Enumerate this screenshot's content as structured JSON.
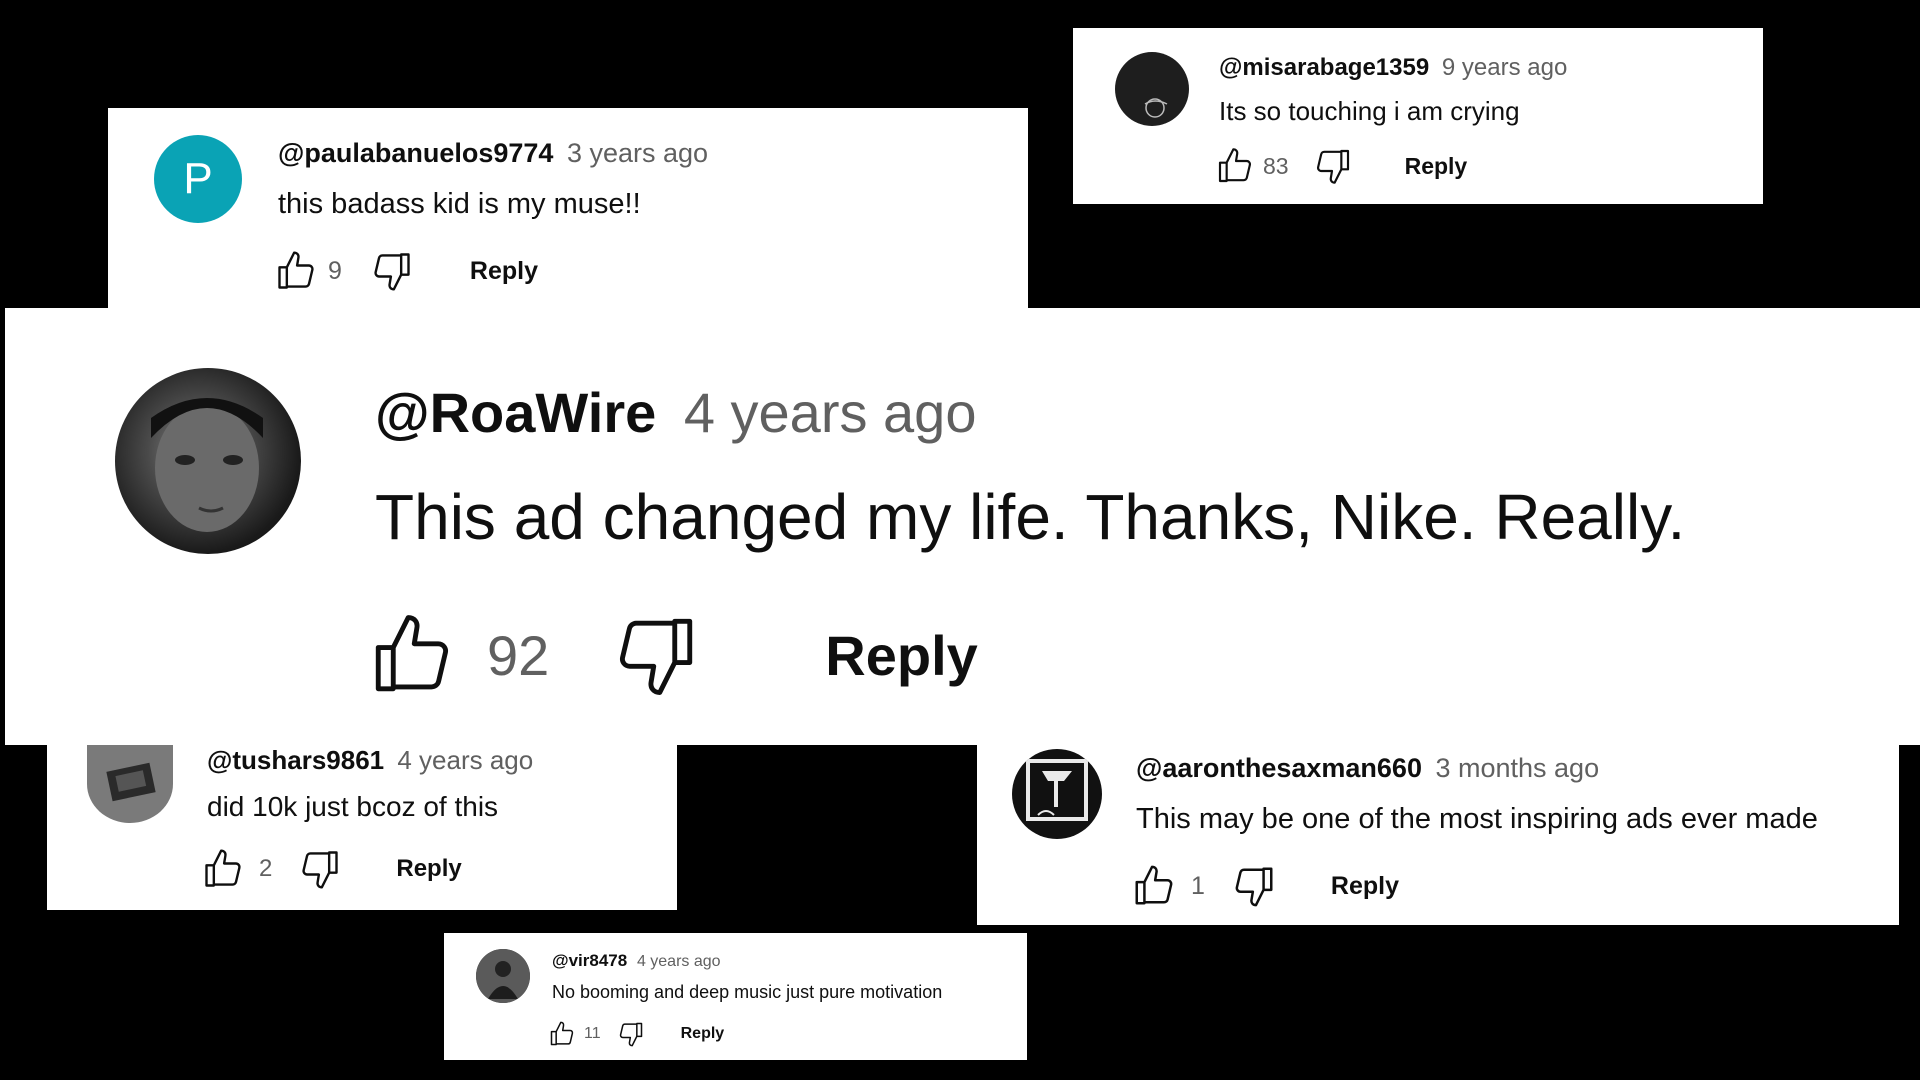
{
  "comments": [
    {
      "handle": "@paulabanuelos9774",
      "time": "3 years ago",
      "text": "this badass kid is my muse!!",
      "likes": "9",
      "reply": "Reply",
      "avatar_letter": "P",
      "avatar_color": "#0aa3b5"
    },
    {
      "handle": "@misarabage1359",
      "time": "9 years ago",
      "text": "Its so touching i am crying",
      "likes": "83",
      "reply": "Reply",
      "avatar_color": "#1e1e1e"
    },
    {
      "handle": "@RoaWire",
      "time": "4 years ago",
      "text": "This ad changed my life. Thanks, Nike. Really.",
      "likes": "92",
      "reply": "Reply",
      "avatar_color": "#2a2a2a"
    },
    {
      "handle": "@tushars9861",
      "time": "4 years ago",
      "text": "did 10k just bcoz of this",
      "likes": "2",
      "reply": "Reply",
      "avatar_color": "#6b6b6b"
    },
    {
      "handle": "@aaronthesaxman660",
      "time": "3 months ago",
      "text": "This may be one of the most inspiring ads ever made",
      "likes": "1",
      "reply": "Reply",
      "avatar_color": "#1a1a1a"
    },
    {
      "handle": "@vir8478",
      "time": "4 years ago",
      "text": "No booming and deep music just pure motivation",
      "likes": "11",
      "reply": "Reply",
      "avatar_color": "#3a3a3a"
    }
  ],
  "icons": {
    "like": "thumbs-up-icon",
    "dislike": "thumbs-down-icon"
  },
  "colors": {
    "background": "#000000",
    "card": "#ffffff",
    "secondary_text": "#606060"
  }
}
